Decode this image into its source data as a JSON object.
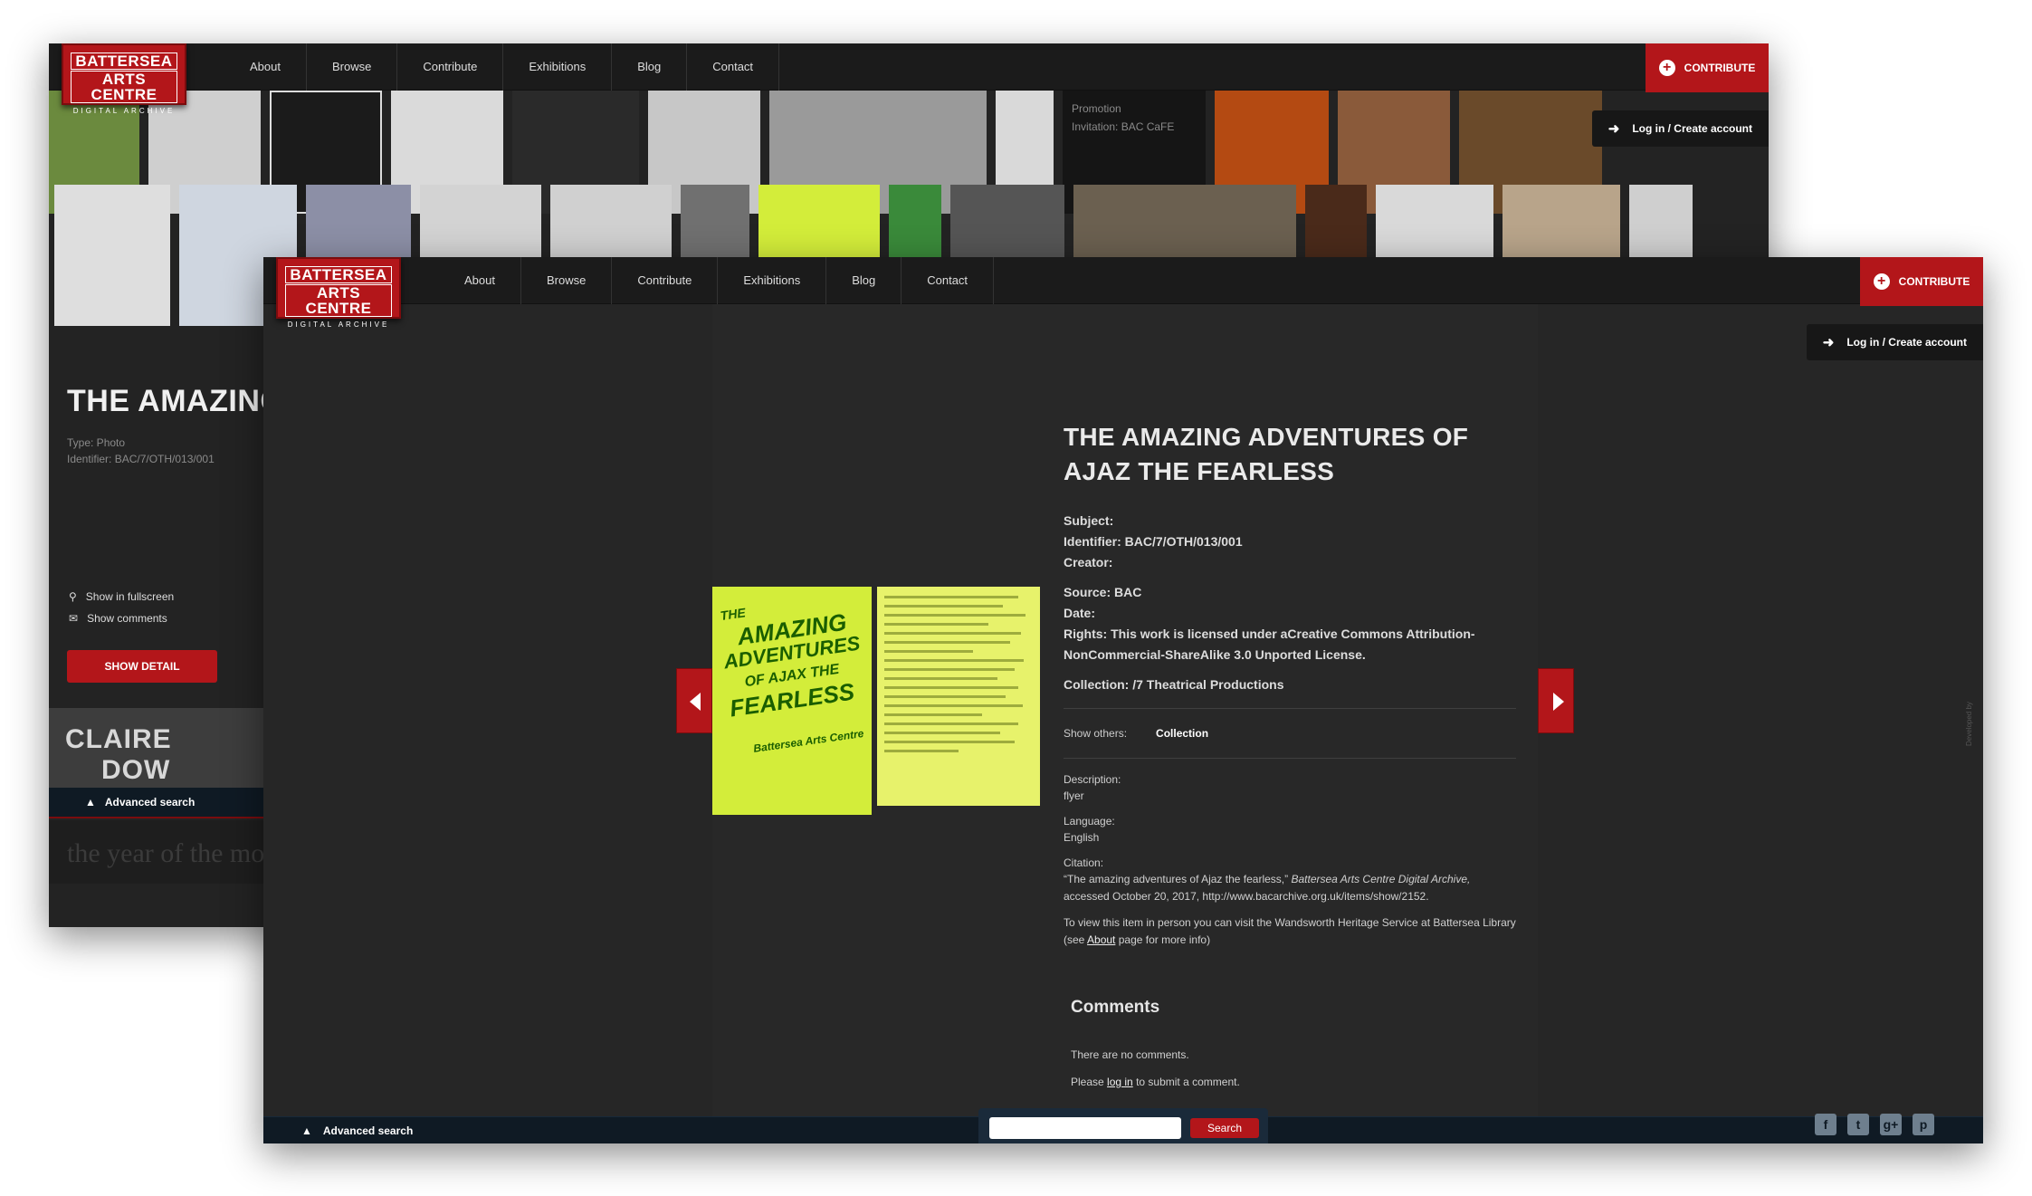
{
  "site": {
    "logo_line1": "BATTERSEA",
    "logo_line2": "ARTS CENTRE",
    "logo_sub": "DIGITAL ARCHIVE",
    "nav": [
      "About",
      "Browse",
      "Contribute",
      "Exhibitions",
      "Blog",
      "Contact"
    ],
    "contribute_label": "CONTRIBUTE",
    "login_label": "Log in / Create account",
    "advanced_search": "Advanced search",
    "search_button": "Search",
    "search_placeholder": ""
  },
  "back": {
    "title": "THE AMAZING A",
    "type": "Type: Photo",
    "identifier": "Identifier: BAC/7/OTH/013/001",
    "fullscreen": "Show in fullscreen",
    "show_comments": "Show comments",
    "show_detail": "SHOW DETAIL",
    "promo_line1": "Promotion",
    "promo_line2": "Invitation: BAC CaFE",
    "claire": "CLAIRE",
    "dow": "DOW",
    "year": "the year of the mon"
  },
  "item": {
    "title": "THE AMAZING ADVENTURES OF AJAZ THE FEARLESS",
    "subject": "Subject:",
    "identifier": "Identifier: BAC/7/OTH/013/001",
    "creator": "Creator:",
    "source": "Source: BAC",
    "date": "Date:",
    "rights": "Rights: This work is licensed under aCreative Commons Attribution-NonCommercial-ShareAlike 3.0 Unported License.",
    "collection": "Collection: /7 Theatrical Productions",
    "show_others_label": "Show others:",
    "show_others_link": "Collection",
    "description_label": "Description:",
    "description_value": "flyer",
    "language_label": "Language:",
    "language_value": "English",
    "citation_label": "Citation:",
    "citation_prefix": "“The amazing adventures of Ajaz the fearless,”",
    "citation_source": "Battersea Arts Centre Digital Archive,",
    "citation_suffix": "accessed October 20, 2017, http://www.bacarchive.org.uk/items/show/2152.",
    "visit_prefix": "To view this item in person you can visit the Wandsworth Heritage Service at Battersea Library (see",
    "visit_link": "About",
    "visit_suffix": "page for more info)",
    "comments_heading": "Comments",
    "no_comments": "There are no comments.",
    "please": "Please",
    "log_in_link": "log in",
    "to_submit": "to submit a comment."
  },
  "flyer": {
    "line1": "THE",
    "line2": "AMAZING",
    "line3": "ADVENTURES",
    "line4": "OF AJAX THE",
    "line5": "FEARLESS",
    "line6": "Battersea Arts Centre"
  },
  "developed_by": "Developed by",
  "icons": [
    "search-icon",
    "comment-icon",
    "chevron-up-icon",
    "login-icon",
    "plus-icon",
    "arrow-left-icon",
    "arrow-right-icon",
    "facebook-icon",
    "twitter-icon",
    "googleplus-icon",
    "pinterest-icon"
  ],
  "social_glyphs": [
    "f",
    "t",
    "g+",
    "p"
  ],
  "colors": {
    "accent": "#b3161a",
    "bar": "#0f1a24",
    "flyer": "#d3ed3a"
  }
}
